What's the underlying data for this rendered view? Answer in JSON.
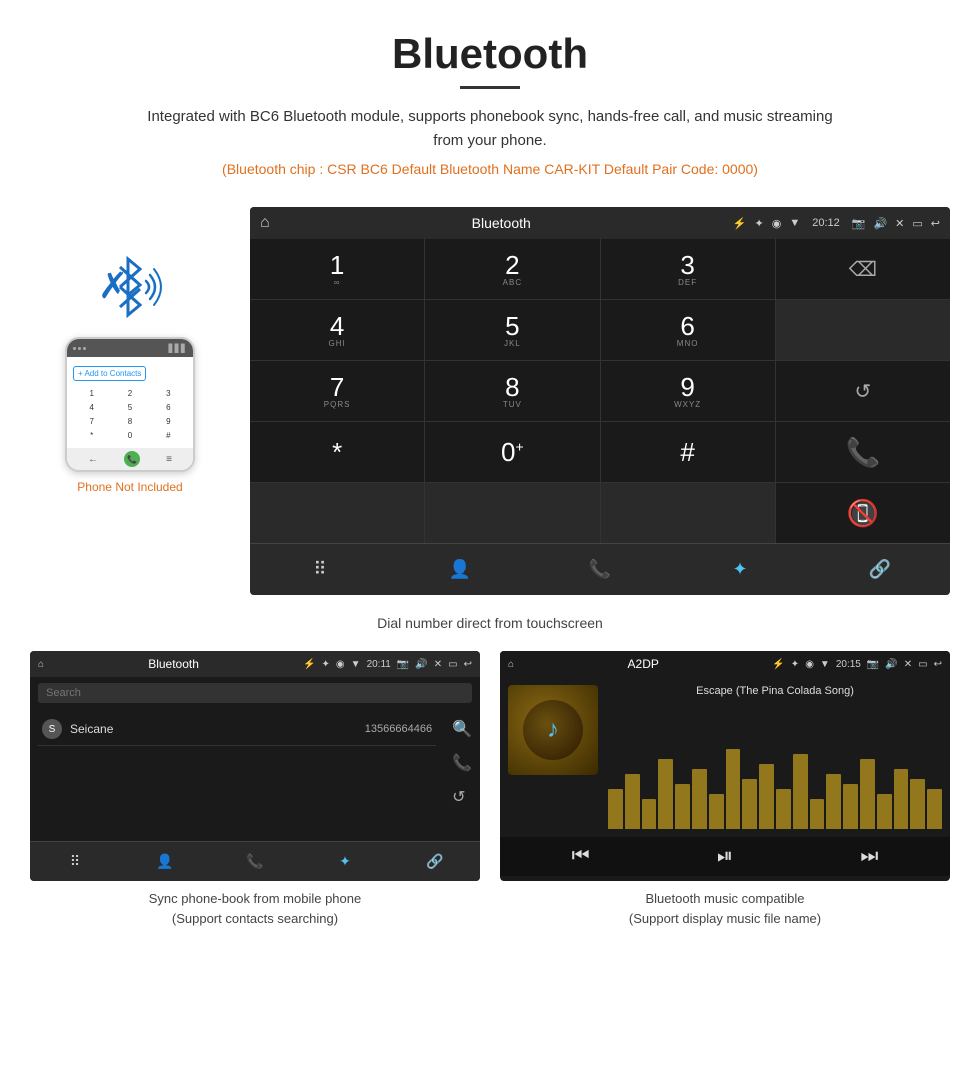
{
  "page": {
    "title": "Bluetooth",
    "description": "Integrated with BC6 Bluetooth module, supports phonebook sync, hands-free call, and music streaming from your phone.",
    "specs": "(Bluetooth chip : CSR BC6    Default Bluetooth Name CAR-KIT    Default Pair Code: 0000)",
    "dial_caption": "Dial number direct from touchscreen",
    "phonebook_caption": "Sync phone-book from mobile phone\n(Support contacts searching)",
    "music_caption": "Bluetooth music compatible\n(Support display music file name)"
  },
  "car_screen": {
    "title": "Bluetooth",
    "time": "20:12",
    "status_icons": "✦ ◉ ▼",
    "dialpad": [
      {
        "num": "1",
        "sub": "∞"
      },
      {
        "num": "2",
        "sub": "ABC"
      },
      {
        "num": "3",
        "sub": "DEF"
      },
      {
        "num": "⌫",
        "sub": ""
      },
      {
        "num": "4",
        "sub": "GHI"
      },
      {
        "num": "5",
        "sub": "JKL"
      },
      {
        "num": "6",
        "sub": "MNO"
      },
      {
        "num": "",
        "sub": ""
      },
      {
        "num": "7",
        "sub": "PQRS"
      },
      {
        "num": "8",
        "sub": "TUV"
      },
      {
        "num": "9",
        "sub": "WXYZ"
      },
      {
        "num": "↺",
        "sub": ""
      },
      {
        "num": "*",
        "sub": ""
      },
      {
        "num": "0",
        "sub": "+"
      },
      {
        "num": "#",
        "sub": ""
      },
      {
        "num": "📞",
        "sub": "green"
      },
      {
        "num": "📵",
        "sub": "red"
      }
    ],
    "bottom_icons": [
      "⠿",
      "👤",
      "📞",
      "✦",
      "🔗"
    ]
  },
  "phonebook_screen": {
    "title": "Bluetooth",
    "time": "20:11",
    "search_placeholder": "Search",
    "contacts": [
      {
        "letter": "S",
        "name": "Seicane",
        "phone": "13566664466"
      }
    ],
    "side_icons": [
      "🔍",
      "📞",
      "↺"
    ],
    "bottom_icons": [
      "⠿",
      "👤",
      "📞",
      "✦",
      "🔗"
    ]
  },
  "music_screen": {
    "title": "A2DP",
    "time": "20:15",
    "song_title": "Escape (The Pina Colada Song)",
    "viz_bars": [
      40,
      55,
      30,
      70,
      45,
      60,
      35,
      80,
      50,
      65,
      40,
      75,
      30,
      55,
      45,
      70,
      35,
      60,
      50,
      40
    ],
    "controls": [
      "⏮",
      "⏯",
      "⏭"
    ],
    "bottom_icons": [
      "⠿",
      "👤",
      "📞",
      "✦",
      "🔗"
    ]
  },
  "phone_mockup": {
    "add_contact_label": "+ Add to Contacts",
    "keys": [
      "1",
      "2",
      "3",
      "4",
      "5",
      "6",
      "7",
      "8",
      "9",
      "*",
      "0",
      "#"
    ],
    "not_included": "Phone Not Included"
  }
}
